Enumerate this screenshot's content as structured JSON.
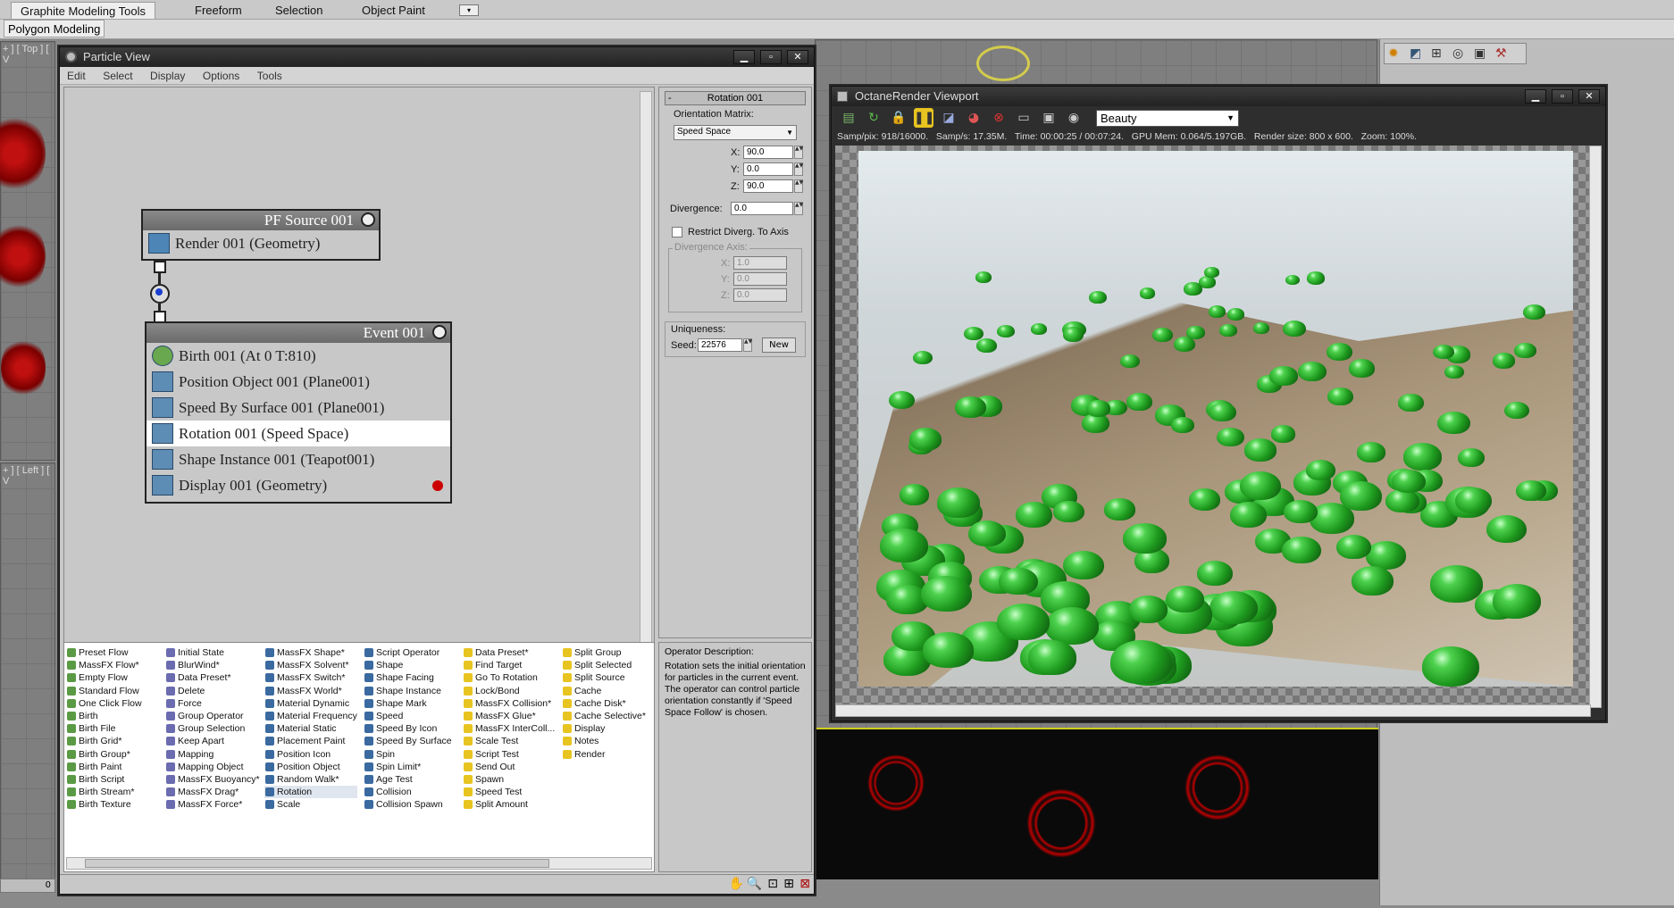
{
  "ribbon": {
    "tabs": [
      "Graphite Modeling Tools",
      "Freeform",
      "Selection",
      "Object Paint"
    ],
    "sub_label": "Polygon Modeling"
  },
  "viewports": {
    "top_label": "+ ] [ Top ] [ V",
    "left_label": "+ ] [ Left ] [ V",
    "frame_counter": "0"
  },
  "particle_view": {
    "title": "Particle View",
    "menu": [
      "Edit",
      "Select",
      "Display",
      "Options",
      "Tools"
    ],
    "source": {
      "title": "PF Source 001",
      "ops": [
        "Render 001 (Geometry)"
      ]
    },
    "event": {
      "title": "Event 001",
      "ops": [
        "Birth 001 (At 0 T:810)",
        "Position Object 001 (Plane001)",
        "Speed By Surface 001 (Plane001)",
        "Rotation 001 (Speed Space)",
        "Shape Instance 001 (Teapot001)",
        "Display 001 (Geometry)"
      ],
      "selected_index": 3
    },
    "params": {
      "rollout_title": "Rotation 001",
      "orientation_label": "Orientation Matrix:",
      "orientation_value": "Speed Space",
      "x_label": "X:",
      "x_value": "90.0",
      "y_label": "Y:",
      "y_value": "0.0",
      "z_label": "Z:",
      "z_value": "90.0",
      "divergence_label": "Divergence:",
      "divergence_value": "0.0",
      "restrict_label": "Restrict Diverg. To Axis",
      "div_axis_label": "Divergence Axis:",
      "dx_value": "1.0",
      "dy_value": "0.0",
      "dz_value": "0.0",
      "uniqueness_label": "Uniqueness:",
      "seed_label": "Seed:",
      "seed_value": "22576",
      "new_button": "New"
    },
    "depot": [
      [
        "Preset Flow",
        "MassFX Flow*",
        "Empty Flow",
        "Standard Flow",
        "One Click Flow",
        "Birth",
        "Birth File",
        "Birth Grid*",
        "Birth Group*",
        "Birth Paint",
        "Birth Script",
        "Birth Stream*",
        "Birth Texture"
      ],
      [
        "Initial State",
        "BlurWind*",
        "Data Preset*",
        "Delete",
        "Force",
        "Group Operator",
        "Group Selection",
        "Keep Apart",
        "Mapping",
        "Mapping Object",
        "MassFX Buoyancy*",
        "MassFX Drag*",
        "MassFX Force*"
      ],
      [
        "MassFX Shape*",
        "MassFX Solvent*",
        "MassFX Switch*",
        "MassFX World*",
        "Material Dynamic",
        "Material Frequency",
        "Material Static",
        "Placement Paint",
        "Position Icon",
        "Position Object",
        "Random Walk*",
        "Rotation",
        "Scale"
      ],
      [
        "Script Operator",
        "Shape",
        "Shape Facing",
        "Shape Instance",
        "Shape Mark",
        "Speed",
        "Speed By Icon",
        "Speed By Surface",
        "Spin",
        "Spin Limit*",
        "Age Test",
        "Collision",
        "Collision Spawn"
      ],
      [
        "Data Preset*",
        "Find Target",
        "Go To Rotation",
        "Lock/Bond",
        "MassFX Collision*",
        "MassFX Glue*",
        "MassFX InterColl...",
        "Scale Test",
        "Script Test",
        "Send Out",
        "Spawn",
        "Speed Test",
        "Split Amount"
      ],
      [
        "Split Group",
        "Split Selected",
        "Split Source",
        "Cache",
        "Cache Disk*",
        "Cache Selective*",
        "Display",
        "Notes",
        "Render"
      ]
    ],
    "description": {
      "label": "Operator Description:",
      "text": "Rotation sets the initial orientation for particles in the current event. The operator can control particle orientation constantly if 'Speed Space Follow' is chosen."
    }
  },
  "octane": {
    "title": "OctaneRender Viewport",
    "pass": "Beauty",
    "stats": "Samp/pix: 918/16000.   Samp/s: 17.35M.   Time: 00:00:25 / 00:07:24.   GPU Mem: 0.064/5.197GB.   Render size: 800 x 600.   Zoom: 100%."
  }
}
